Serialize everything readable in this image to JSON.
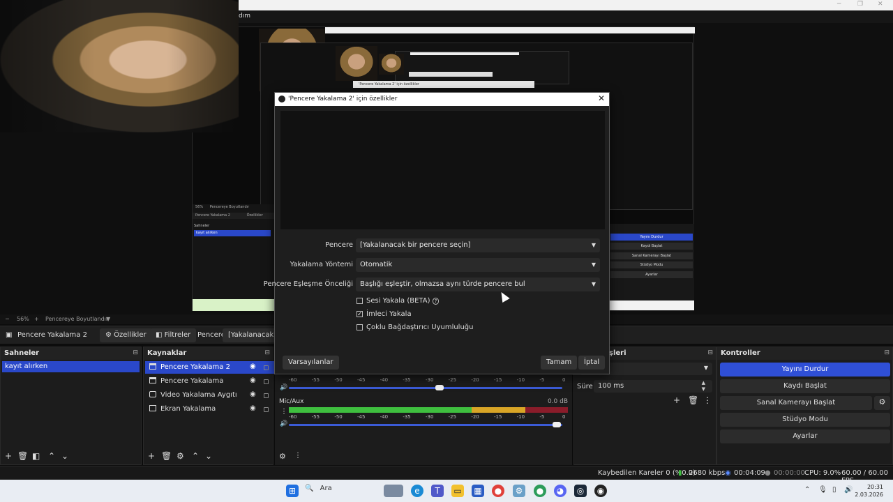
{
  "app": {
    "menu_partial": "dım",
    "zoom_level": "56%",
    "zoom_label": "Pencereye Boyutlandır"
  },
  "propbar": {
    "source_name": "Pencere Yakalama 2",
    "properties_label": "Özellikler",
    "filters_label": "Filtreler",
    "window_label": "Pencere",
    "window_value": "[Yakalanacak bir p"
  },
  "scenes": {
    "title": "Sahneler",
    "items": [
      "kayıt alırken"
    ]
  },
  "sources": {
    "title": "Kaynaklar",
    "items": [
      {
        "label": "Pencere Yakalama 2",
        "icon": "window-icon",
        "selected": true
      },
      {
        "label": "Pencere Yakalama",
        "icon": "window-icon",
        "selected": false
      },
      {
        "label": "Video Yakalama Aygıtı",
        "icon": "camera-icon",
        "selected": false
      },
      {
        "label": "Ekran Yakalama",
        "icon": "monitor-icon",
        "selected": false
      }
    ]
  },
  "mixer": {
    "ticks": [
      "-60",
      "-55",
      "-50",
      "-45",
      "-40",
      "-35",
      "-30",
      "-25",
      "-20",
      "-15",
      "-10",
      "-5",
      "0"
    ],
    "channel2_name": "Mic/Aux",
    "channel2_db": "0.0 dB",
    "channel1_volume": 0.55,
    "channel2_volume": 0.98
  },
  "transitions": {
    "title_partial": "şleri",
    "duration_label": "Süre",
    "duration_value": "100 ms"
  },
  "controls": {
    "title": "Kontroller",
    "stop_stream": "Yayını Durdur",
    "start_record": "Kaydı Başlat",
    "virtual_cam": "Sanal Kamerayı Başlat",
    "studio_mode": "Stüdyo Modu",
    "settings": "Ayarlar"
  },
  "status": {
    "dropped_frames": "Kaybedilen Kareler 0 (%0.0)",
    "bitrate": "2680 kbps",
    "stream_time": "00:04:09",
    "record_time": "00:00:00",
    "cpu": "CPU: 9.0%",
    "fps": "60.00 / 60.00 FPS"
  },
  "dialog": {
    "title": "'Pencere Yakalama 2' için özellikler",
    "window_label": "Pencere",
    "window_value": "[Yakalanacak bir pencere seçin]",
    "method_label": "Yakalama Yöntemi",
    "method_value": "Otomatik",
    "priority_label": "Pencere Eşleşme Önceliği",
    "priority_value": "Başlığı eşleştir, olmazsa aynı türde pencere bul",
    "capture_audio": "Sesi Yakala (BETA)",
    "capture_cursor": "İmleci Yakala",
    "multi_adapter": "Çoklu Bağdaştırıcı Uyumluluğu",
    "capture_cursor_checked": true,
    "defaults_button": "Varsayılanlar",
    "ok_button": "Tamam",
    "cancel_button": "İptal"
  },
  "taskbar": {
    "search_placeholder": "Ara",
    "time": "20:31",
    "date": "2.03.2026"
  },
  "nested_preview": {
    "dialog_title": "'Pencere Yakalama 2' için özellikler",
    "scenes_title": "Sahneler",
    "scene_item": "kayıt alırken",
    "source_item": "Pencere Yakalama 2",
    "props_label": "Özellikler",
    "zoom": "56%",
    "fit_label": "Pencereye Boyutlandır",
    "ctrl_stop": "Yayını Durdur",
    "ctrl_record": "Kaydı Başlat",
    "ctrl_vcam": "Sanal Kamerayı Başlat",
    "ctrl_studio": "Stüdyo Modu",
    "ctrl_settings": "Ayarlar"
  }
}
